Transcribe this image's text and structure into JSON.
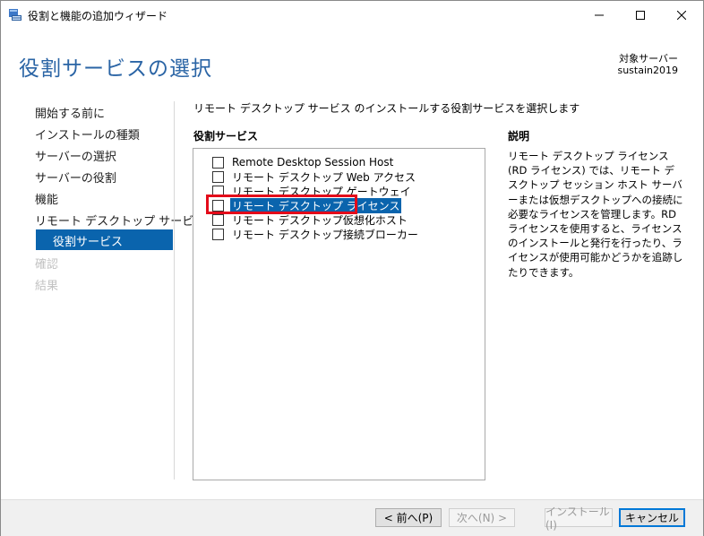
{
  "window": {
    "title": "役割と機能の追加ウィザード"
  },
  "header": {
    "page_title": "役割サービスの選択",
    "target_label": "対象サーバー",
    "target_name": "sustain2019"
  },
  "nav": {
    "items": [
      {
        "label": "開始する前に",
        "state": "normal"
      },
      {
        "label": "インストールの種類",
        "state": "normal"
      },
      {
        "label": "サーバーの選択",
        "state": "normal"
      },
      {
        "label": "サーバーの役割",
        "state": "normal"
      },
      {
        "label": "機能",
        "state": "normal"
      },
      {
        "label": "リモート デスクトップ サービス",
        "state": "normal"
      },
      {
        "label": "役割サービス",
        "state": "selected"
      },
      {
        "label": "確認",
        "state": "disabled"
      },
      {
        "label": "結果",
        "state": "disabled"
      }
    ]
  },
  "main": {
    "instruction": "リモート デスクトップ サービス のインストールする役割サービスを選択します",
    "section_label": "役割サービス",
    "role_services": [
      {
        "label": "Remote Desktop Session Host",
        "checked": false
      },
      {
        "label": "リモート デスクトップ Web アクセス",
        "checked": false
      },
      {
        "label": "リモート デスクトップ ゲートウェイ",
        "checked": false
      },
      {
        "label": "リモート デスクトップ ライセンス",
        "checked": false,
        "selected": true
      },
      {
        "label": "リモート デスクトップ仮想化ホスト",
        "checked": false
      },
      {
        "label": "リモート デスクトップ接続ブローカー",
        "checked": false
      }
    ]
  },
  "description": {
    "title": "説明",
    "text": "リモート デスクトップ ライセンス (RD ライセンス) では、リモート デスクトップ セッション ホスト サーバーまたは仮想デスクトップへの接続に必要なライセンスを管理します。RD ライセンスを使用すると、ライセンスのインストールと発行を行ったり、ライセンスが使用可能かどうかを追跡したりできます。"
  },
  "footer": {
    "prev": "< 前へ(P)",
    "next": "次へ(N) >",
    "install": "インストール(I)",
    "cancel": "キャンセル"
  },
  "colors": {
    "accent": "#0a64ad",
    "title_blue": "#2a64a5",
    "highlight_red": "#e30b1a"
  }
}
